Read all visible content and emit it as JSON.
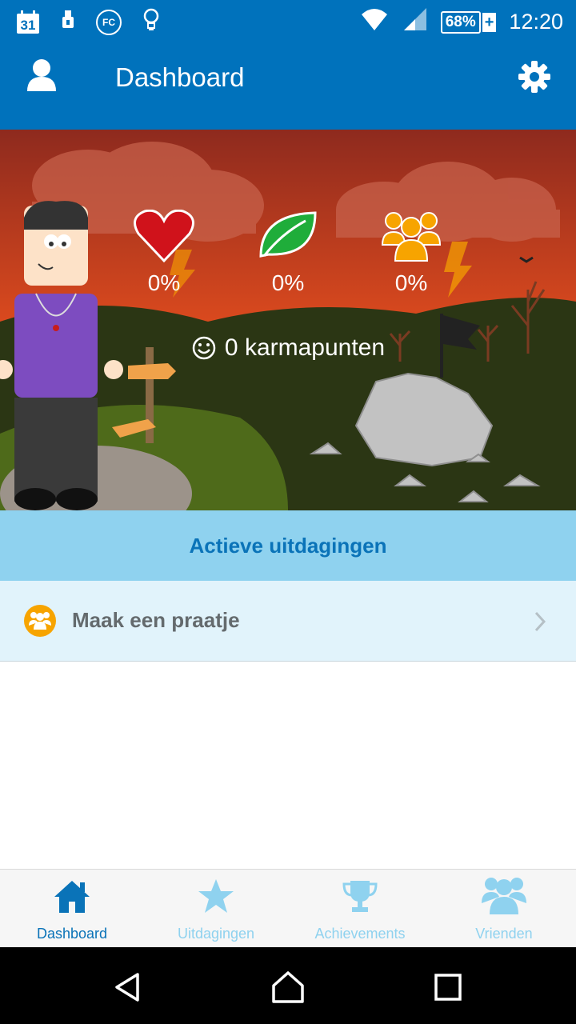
{
  "status_bar": {
    "calendar_day": "31",
    "fc_label": "FC",
    "battery": "68%",
    "battery_charging": "+",
    "time": "12:20",
    "icons": [
      "calendar-icon",
      "sim-icon",
      "fc-icon",
      "lightbulb-icon",
      "wifi-icon",
      "signal-icon",
      "battery-icon"
    ]
  },
  "app_bar": {
    "title": "Dashboard",
    "left_icon": "profile-icon",
    "right_icon": "gear-icon"
  },
  "hero": {
    "stats": [
      {
        "icon": "heart-icon",
        "value": "0%",
        "color": "#d0121b"
      },
      {
        "icon": "leaf-icon",
        "value": "0%",
        "color": "#1fad3a"
      },
      {
        "icon": "group-icon",
        "value": "0%",
        "color": "#f7a400"
      }
    ],
    "karma": {
      "icon": "smiley-icon",
      "text": "0 karmapunten"
    }
  },
  "section": {
    "title": "Actieve uitdagingen"
  },
  "challenges": [
    {
      "label": "Maak een praatje",
      "icon": "group-icon",
      "icon_color": "#f7a400"
    }
  ],
  "bottom_nav": {
    "items": [
      {
        "label": "Dashboard",
        "icon": "home-icon",
        "active": true
      },
      {
        "label": "Uitdagingen",
        "icon": "star-icon",
        "active": false
      },
      {
        "label": "Achievements",
        "icon": "trophy-icon",
        "active": false
      },
      {
        "label": "Vrienden",
        "icon": "friends-icon",
        "active": false
      }
    ]
  },
  "colors": {
    "primary": "#0072bc",
    "section_bg": "#8fd2ef",
    "row_bg": "#e1f3fb",
    "nav_active": "#0a73b8",
    "nav_inactive": "#8fd2ef"
  }
}
